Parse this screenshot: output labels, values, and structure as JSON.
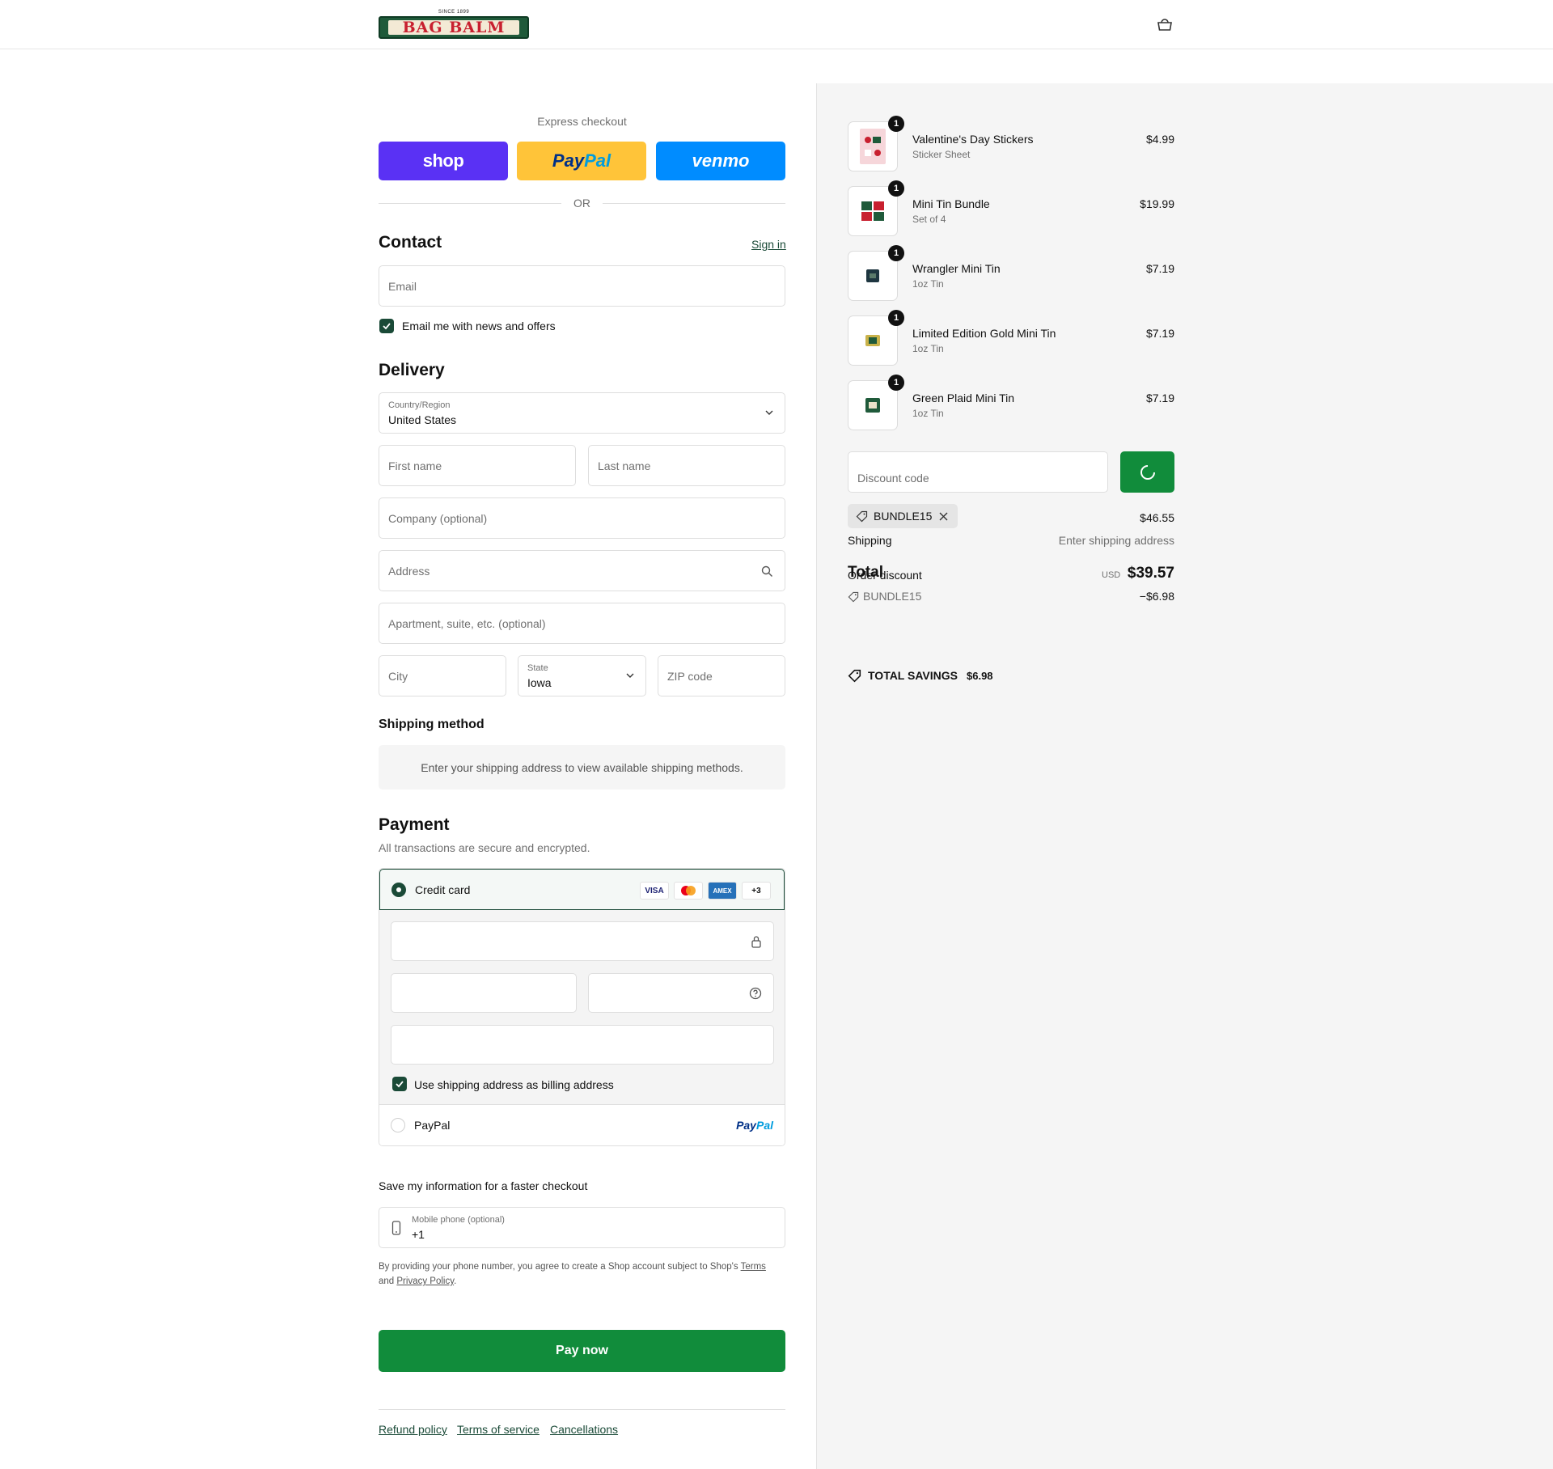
{
  "header": {
    "logo": {
      "since": "SINCE 1899",
      "name": "BAG BALM"
    }
  },
  "express": {
    "title": "Express checkout",
    "shop_label": "shop",
    "paypal_label_1": "Pay",
    "paypal_label_2": "Pal",
    "venmo_label": "venmo",
    "or": "OR"
  },
  "contact": {
    "title": "Contact",
    "sign_in": "Sign in",
    "email_placeholder": "Email",
    "news_label": "Email me with news and offers"
  },
  "delivery": {
    "title": "Delivery",
    "country_label": "Country/Region",
    "country_value": "United States",
    "first_name": "First name",
    "last_name": "Last name",
    "company": "Company (optional)",
    "address": "Address",
    "apartment": "Apartment, suite, etc. (optional)",
    "city": "City",
    "state_label": "State",
    "state_value": "Iowa",
    "zip": "ZIP code"
  },
  "shipping_method": {
    "title": "Shipping method",
    "note": "Enter your shipping address to view available shipping methods."
  },
  "payment": {
    "title": "Payment",
    "subtitle": "All transactions are secure and encrypted.",
    "credit_card": "Credit card",
    "card_logos": [
      "VISA",
      "",
      "AMEX",
      "+3"
    ],
    "billing_label": "Use shipping address as billing address",
    "paypal_option": "PayPal",
    "paypal_logo_1": "Pay",
    "paypal_logo_2": "Pal"
  },
  "save_info": {
    "title": "Save my information for a faster checkout",
    "phone_label": "Mobile phone (optional)",
    "phone_value": "+1",
    "legal_1": "By providing your phone number, you agree to create a Shop account subject to Shop's ",
    "terms": "Terms",
    "legal_2": "and ",
    "privacy": "Privacy Policy",
    "legal_3": "."
  },
  "pay_now": "Pay now",
  "footer": {
    "refund": "Refund policy",
    "terms": "Terms of service",
    "cancellations": "Cancellations"
  },
  "cart": {
    "items": [
      {
        "name": "Valentine's Day Stickers",
        "sub": "Sticker Sheet",
        "price": "$4.99",
        "qty": "1"
      },
      {
        "name": "Mini Tin Bundle",
        "sub": "Set of 4",
        "price": "$19.99",
        "qty": "1"
      },
      {
        "name": "Wrangler Mini Tin",
        "sub": "1oz Tin",
        "price": "$7.19",
        "qty": "1"
      },
      {
        "name": "Limited Edition Gold Mini Tin",
        "sub": "1oz Tin",
        "price": "$7.19",
        "qty": "1"
      },
      {
        "name": "Green Plaid Mini Tin",
        "sub": "1oz Tin",
        "price": "$7.19",
        "qty": "1"
      }
    ],
    "discount_placeholder": "Discount code",
    "applied_code": "BUNDLE15",
    "subtotal_value": "$46.55",
    "shipping_label": "Shipping",
    "shipping_value": "Enter shipping address",
    "total_label": "Total",
    "order_discount_label": "Order discount",
    "currency": "USD",
    "total_value": "$39.57",
    "discount_code": "BUNDLE15",
    "discount_value": "−$6.98",
    "savings_label": "TOTAL SAVINGS",
    "savings_value": "$6.98"
  },
  "colors": {
    "brand_green": "#1a4a37",
    "pay_green": "#118c3b",
    "shop_purple": "#5a31f4",
    "paypal_yellow": "#ffc439",
    "venmo_blue": "#008cff"
  }
}
